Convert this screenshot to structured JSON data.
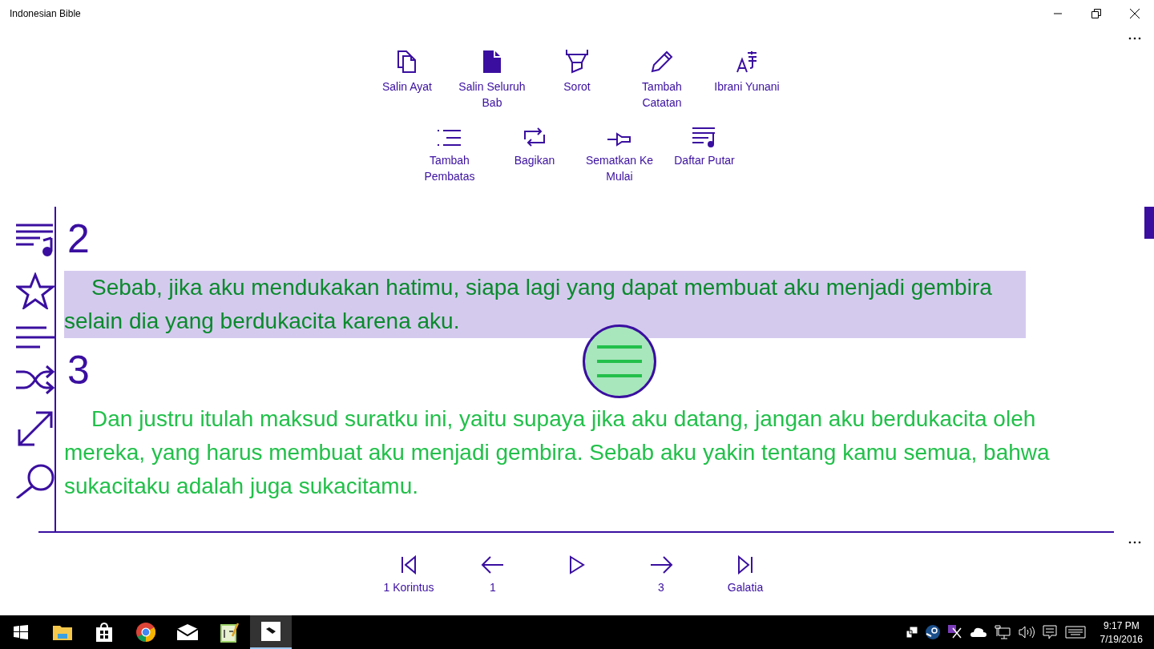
{
  "window": {
    "title": "Indonesian Bible"
  },
  "actions_row_1": [
    {
      "label": "Salin Ayat"
    },
    {
      "label": "Salin Seluruh Bab"
    },
    {
      "label": "Sorot"
    },
    {
      "label": "Tambah Catatan"
    },
    {
      "label": "Ibrani Yunani"
    }
  ],
  "actions_row_2": [
    {
      "label": "Tambah Pembatas"
    },
    {
      "label": "Bagikan"
    },
    {
      "label": "Sematkan Ke Mulai"
    },
    {
      "label": "Daftar Putar"
    }
  ],
  "verses": [
    {
      "number": "2",
      "text": "Sebab, jika aku mendukakan hatimu, siapa lagi yang dapat membuat aku menjadi gembira selain dia yang berdukacita karena aku.",
      "selected": true
    },
    {
      "number": "3",
      "text": "Dan justru itulah maksud suratku ini, yaitu supaya jika aku datang, jangan aku berdukacita oleh mereka, yang harus membuat aku menjadi gembira. Sebab aku yakin tentang kamu semua, bahwa sukacitaku adalah juga sukacitamu.",
      "selected": false
    }
  ],
  "navigation": [
    {
      "kind": "first",
      "label": "1 Korintus"
    },
    {
      "kind": "previous",
      "label": "1"
    },
    {
      "kind": "play"
    },
    {
      "kind": "next",
      "label": "3"
    },
    {
      "kind": "last",
      "label": "Galatia"
    }
  ],
  "taskbar": {
    "apps": [
      {
        "kind": "start",
        "selected": false
      },
      {
        "kind": "folder",
        "selected": false
      },
      {
        "kind": "store",
        "selected": false
      },
      {
        "kind": "browser",
        "selected": false
      },
      {
        "kind": "mail",
        "selected": false
      },
      {
        "kind": "notepad",
        "selected": false
      },
      {
        "kind": "bible",
        "selected": true
      }
    ],
    "time": "9:17 PM",
    "date": "7/19/2016"
  }
}
